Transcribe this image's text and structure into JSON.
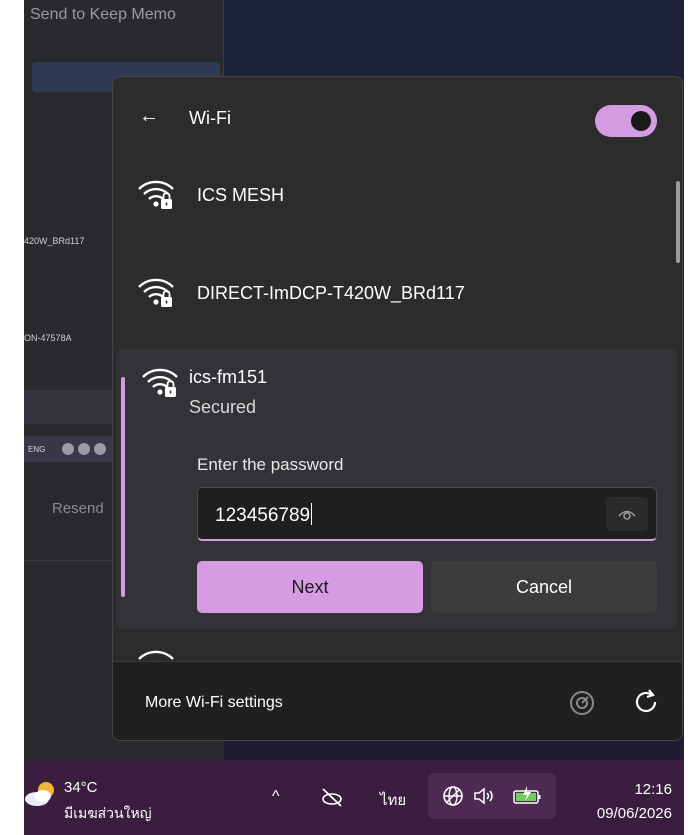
{
  "background_app": {
    "title": "Send to Keep Memo",
    "list_items": [
      "420W_BRd117",
      "ON-47578A"
    ],
    "toolbar_text": "ENG",
    "resend_label": "Resend"
  },
  "wifi_flyout": {
    "title": "Wi-Fi",
    "back_icon": "back-arrow-icon",
    "toggle": {
      "state": "on",
      "color": "#d59be3"
    },
    "networks": [
      {
        "name": "ICS MESH",
        "icon": "wifi-secured-icon"
      },
      {
        "name": "DIRECT-ImDCP-T420W_BRd117",
        "icon": "wifi-secured-icon"
      }
    ],
    "selected_network": {
      "name": "ics-fm151",
      "status": "Secured",
      "password_label": "Enter the password",
      "password_value": "123456789",
      "reveal_icon": "eye-icon",
      "next_label": "Next",
      "cancel_label": "Cancel"
    },
    "footer": {
      "more_settings_label": "More Wi-Fi settings",
      "speed_icon": "network-speed-icon",
      "refresh_icon": "refresh-icon"
    },
    "accent_color": "#d59be3"
  },
  "taskbar": {
    "weather": {
      "temperature": "34°C",
      "description": "มีเมฆส่วนใหญ่",
      "icon": "partly-cloudy-icon"
    },
    "tray": {
      "overflow_icon": "chevron-up-icon",
      "cloud_icon": "cloud-offline-icon",
      "language": "ไทย",
      "globe_icon": "globe-icon",
      "volume_icon": "volume-icon",
      "battery_icon": "battery-charging-icon"
    },
    "clock": {
      "time": "12:16",
      "date": "09/06/2026"
    }
  }
}
